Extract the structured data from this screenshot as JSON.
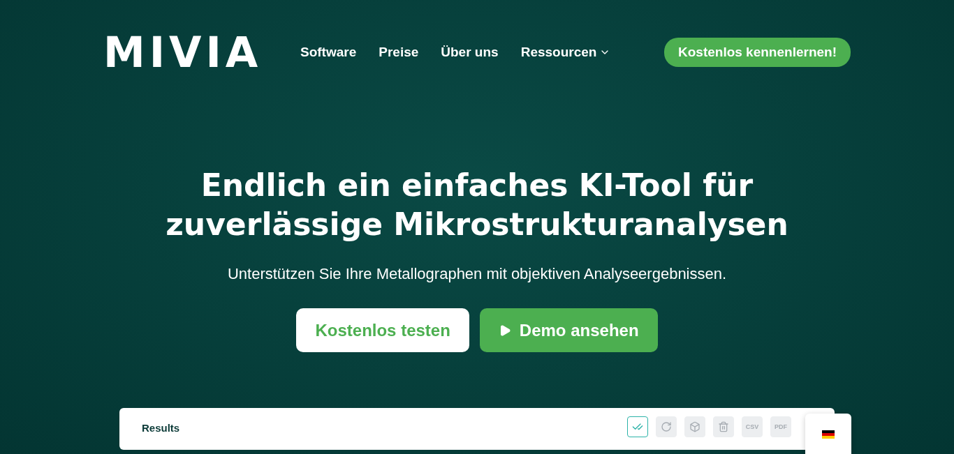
{
  "logo": "MIVIA",
  "nav": [
    {
      "label": "Software",
      "kind": "link"
    },
    {
      "label": "Preise",
      "kind": "link"
    },
    {
      "label": "Über uns",
      "kind": "link"
    },
    {
      "label": "Ressourcen",
      "kind": "dropdown"
    }
  ],
  "cta": "Kostenlos kennenlernen!",
  "hero": {
    "title": "Endlich ein einfaches KI-Tool für zuverlässige Mikrostrukturanalysen",
    "subtitle": "Unterstützen Sie Ihre Metallographen mit objektiven Analyseergebnissen.",
    "buttons": [
      {
        "label": "Kostenlos testen",
        "kind": "outline"
      },
      {
        "label": "Demo ansehen",
        "kind": "play"
      }
    ]
  },
  "preview": {
    "title": "Results",
    "tools": [
      {
        "kind": "check",
        "selected": true
      },
      {
        "kind": "refresh",
        "selected": false
      },
      {
        "kind": "box",
        "selected": false
      },
      {
        "kind": "trash",
        "selected": false
      },
      {
        "kind": "text",
        "label": "CSV",
        "selected": false
      },
      {
        "kind": "text",
        "label": "PDF",
        "selected": false
      }
    ]
  }
}
